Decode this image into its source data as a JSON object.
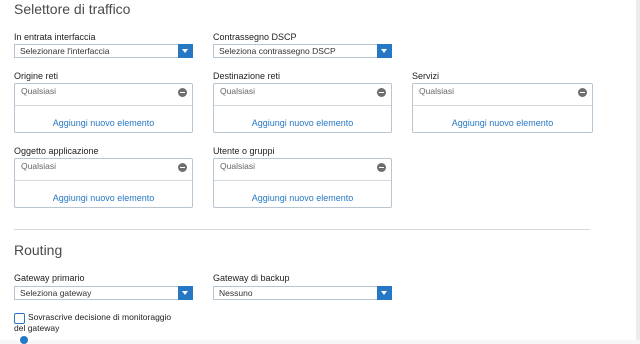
{
  "traffic_selector": {
    "title": "Selettore di traffico",
    "incoming_interface": {
      "label": "In entrata interfaccia",
      "value": "Selezionare l'interfaccia"
    },
    "dscp_marking": {
      "label": "Contrassegno DSCP",
      "value": "Seleziona contrassegno DSCP"
    },
    "source_networks": {
      "label": "Origine reti",
      "value": "Qualsiasi",
      "add": "Aggiungi nuovo elemento"
    },
    "destination_networks": {
      "label": "Destinazione reti",
      "value": "Qualsiasi",
      "add": "Aggiungi nuovo elemento"
    },
    "services": {
      "label": "Servizi",
      "value": "Qualsiasi",
      "add": "Aggiungi nuovo elemento"
    },
    "application_object": {
      "label": "Oggetto applicazione",
      "value": "Qualsiasi",
      "add": "Aggiungi nuovo elemento"
    },
    "users_groups": {
      "label": "Utente o gruppi",
      "value": "Qualsiasi",
      "add": "Aggiungi nuovo elemento"
    }
  },
  "routing": {
    "title": "Routing",
    "primary_gateway": {
      "label": "Gateway primario",
      "value": "Seleziona gateway"
    },
    "backup_gateway": {
      "label": "Gateway di backup",
      "value": "Nessuno"
    },
    "override_checkbox": {
      "label": "Sovrascrive decisione di monitoraggio del gateway",
      "checked": false
    }
  },
  "colors": {
    "accent": "#2778c4",
    "border": "#b8c4cf",
    "minus_icon": "#6e6e6e"
  },
  "icons": [
    "chevron-down-icon",
    "remove-icon",
    "info-icon"
  ]
}
